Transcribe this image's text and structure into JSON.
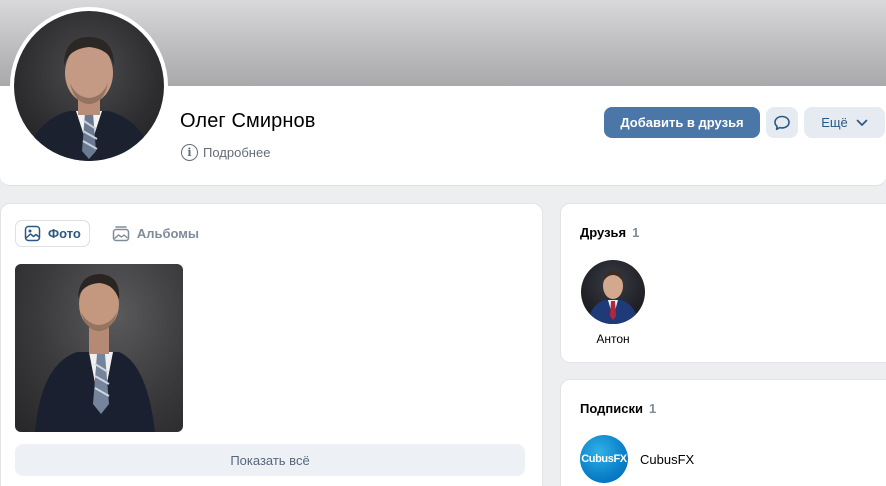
{
  "profile": {
    "name": "Олег Смирнов",
    "more_info": "Подробнее",
    "add_friend": "Добавить в друзья",
    "more": "Ещё"
  },
  "photos": {
    "tabs": [
      {
        "label": "Фото",
        "active": true,
        "icon": "image-icon"
      },
      {
        "label": "Альбомы",
        "active": false,
        "icon": "albums-icon"
      }
    ],
    "show_all": "Показать всё"
  },
  "friends": {
    "title": "Друзья",
    "count": "1",
    "items": [
      {
        "name": "Антон"
      }
    ]
  },
  "subscriptions": {
    "title": "Подписки",
    "count": "1",
    "items": [
      {
        "name": "CubusFX",
        "logo_text": "CubusFX"
      }
    ]
  },
  "colors": {
    "accent": "#4a76a8",
    "secondary_button": "#e5ebf1",
    "page_bg": "#edeef0",
    "link": "#2a5885",
    "muted": "#818c99"
  }
}
